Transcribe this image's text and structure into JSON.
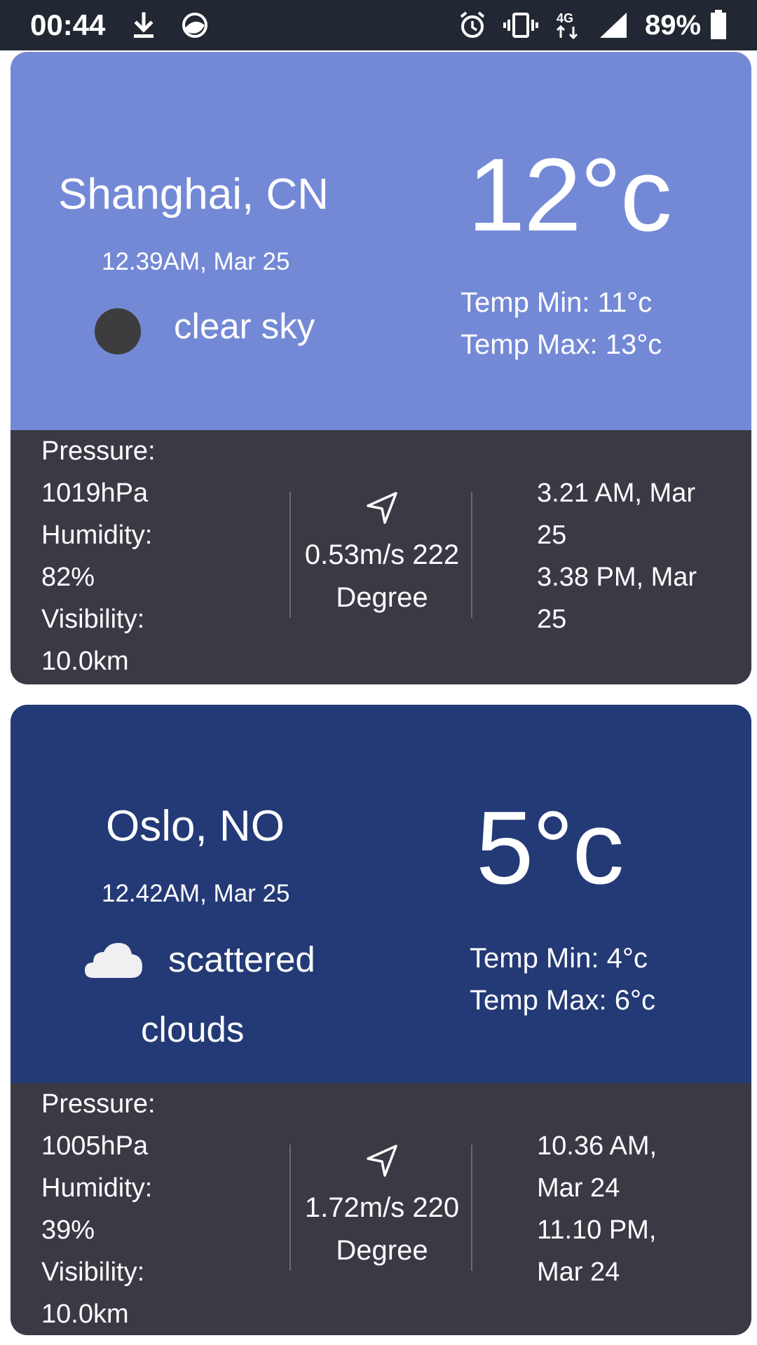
{
  "status_bar": {
    "time": "00:44",
    "battery_percent": "89%",
    "network": "4G"
  },
  "cards": [
    {
      "city": "Shanghai, CN",
      "datetime": "12.39AM, Mar 25",
      "condition": "clear sky",
      "condition_icon": "dark-circle-icon",
      "temperature": "12°c",
      "temp_min": "Temp Min: 11°c",
      "temp_max": "Temp Max: 13°c",
      "top_color": "#7489d6",
      "pressure_label": "Pressure:",
      "pressure_value": "1019hPa",
      "humidity_label": "Humidity:",
      "humidity_value": "82%",
      "visibility_label": "Visibility:",
      "visibility_value": "10.0km",
      "wind_line1": "0.53m/s 222",
      "wind_line2": "Degree",
      "sunrise_line1": "3.21 AM, Mar",
      "sunrise_line2": "25",
      "sunset_line1": "3.38 PM, Mar",
      "sunset_line2": "25"
    },
    {
      "city": "Oslo, NO",
      "datetime": "12.42AM, Mar 25",
      "condition": "scattered",
      "condition_line2": "clouds",
      "condition_icon": "cloud-icon",
      "temperature": "5°c",
      "temp_min": "Temp Min: 4°c",
      "temp_max": "Temp Max: 6°c",
      "top_color": "#233a76",
      "pressure_label": "Pressure:",
      "pressure_value": "1005hPa",
      "humidity_label": "Humidity:",
      "humidity_value": "39%",
      "visibility_label": "Visibility:",
      "visibility_value": "10.0km",
      "wind_line1": "1.72m/s 220",
      "wind_line2": "Degree",
      "sunrise_line1": "10.36 AM,",
      "sunrise_line2": "Mar 24",
      "sunset_line1": "11.10 PM,",
      "sunset_line2": "Mar 24"
    }
  ]
}
